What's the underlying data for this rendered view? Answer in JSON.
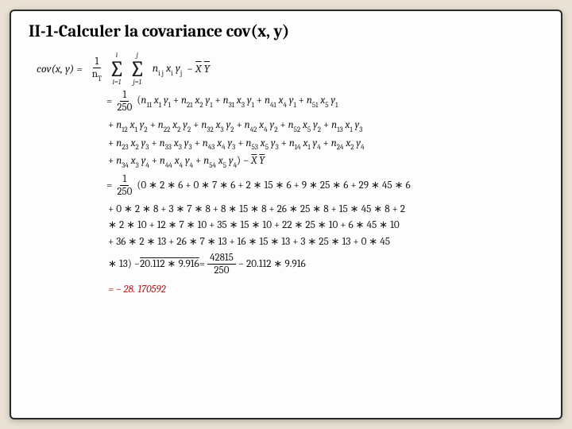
{
  "title": "II-1-Calculer la covariance cov(x, y)",
  "lhs": "cov(x, y) =",
  "general": {
    "frac_num": "1",
    "frac_den": "nT",
    "sum1_top": "i",
    "sum1_bot": "i=1",
    "sum2_top": "j",
    "sum2_bot": "j=1",
    "term": "ni j xi yj",
    "minus_xy": "− X̄ Ȳ"
  },
  "lines": {
    "l1a": "=",
    "l1_num": "1",
    "l1_den": "250",
    "l1b": "(n11 x1 y1 + n21 x2 y1 + n31 x3 y1 + n41 x4 y1 + n51 x5 y1",
    "l2": "+ n12 x1 y2 + n22 x2 y2 + n32 x3 y2 + n42 x4 y2 + n52 x5 y2 + n13 x1 y3",
    "l3": "+ n23 x2 y3 + n33 x3 y3 + n43 x4 y3 + n53 x5 y3 + n14 x1 y4 + n24 x2 y4",
    "l4": "+ n34 x3 y4 + n44 x4 y4 + n54 x5 y4) − X̄ Ȳ",
    "l5a": "=",
    "l5_num": "1",
    "l5_den": "250",
    "l5b": "(0 ∗ 2 ∗ 6 + 0 ∗ 7 ∗ 6 + 2 ∗ 15 ∗ 6 + 9 ∗ 25 ∗ 6 + 29 ∗ 45 ∗ 6",
    "l6": "+ 0 ∗ 2 ∗ 8 + 3 ∗ 7 ∗ 8 + 8 ∗ 15 ∗ 8 + 26 ∗ 25 ∗ 8 + 15 ∗ 45 ∗ 8 + 2",
    "l7": "∗ 2 ∗ 10 + 12 ∗ 7 ∗ 10 + 35 ∗ 15 ∗ 10 + 22 ∗ 25 ∗ 10 + 6 ∗ 45 ∗ 10",
    "l8": "+ 36 ∗ 2 ∗ 13 + 26 ∗ 7 ∗ 13 + 16 ∗ 15 ∗ 13 + 3 ∗ 25 ∗ 13 + 0 ∗ 45",
    "l9a": "∗ 13) − ",
    "l9b": "20.112 ∗ 9.916",
    "l9c": " = ",
    "l9_num": "42815",
    "l9_den": "250",
    "l9d": " − 20.112 ∗ 9.916",
    "l10": "= − 28. 170592"
  }
}
